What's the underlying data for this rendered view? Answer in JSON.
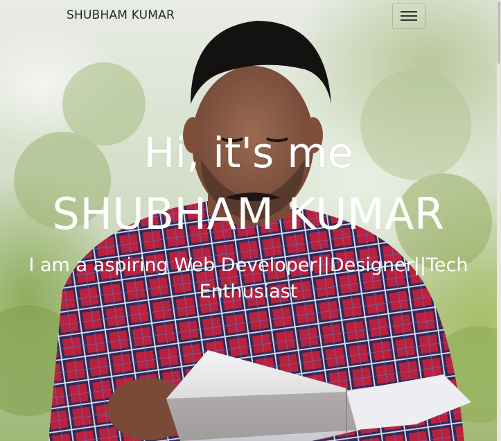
{
  "navbar": {
    "brand": "SHUBHAM KUMAR",
    "menu_icon": "hamburger-menu-icon"
  },
  "hero": {
    "greeting": "Hi, it's me",
    "name": "SHUBHAM KUMAR",
    "tagline_line1": "I am a aspiring Web Developer||Designer||Tech",
    "tagline_line2": "Enthusiast"
  },
  "colors": {
    "hero_text": "#ffffff",
    "brand_text": "#1e2a1c",
    "shirt_red": "#c2274a",
    "shirt_navy": "#223063"
  }
}
